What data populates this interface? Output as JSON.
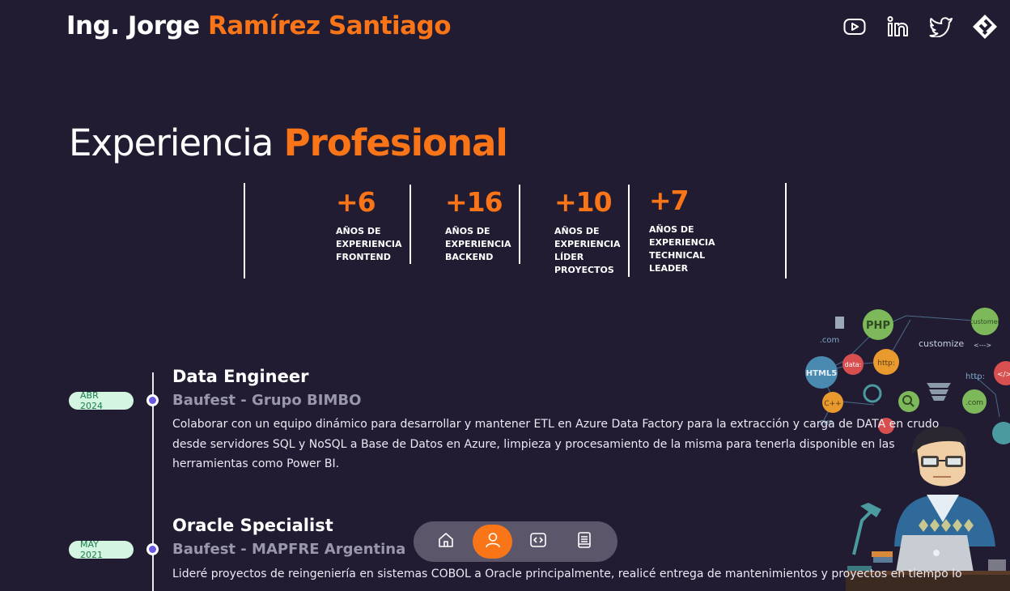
{
  "header": {
    "name_first": "Ing. Jorge ",
    "name_last": "Ramírez Santiago",
    "social": [
      "youtube-icon",
      "linkedin-icon",
      "twitter-icon",
      "platzi-icon"
    ]
  },
  "section": {
    "title_plain": "Experiencia ",
    "title_accent": "Profesional"
  },
  "stats": [
    {
      "value": "+6",
      "label_lines": [
        "AÑOS DE",
        "EXPERIENCIA",
        "FRONTEND"
      ]
    },
    {
      "value": "+16",
      "label_lines": [
        "AÑOS DE",
        "EXPERIENCIA",
        "BACKEND"
      ]
    },
    {
      "value": "+10",
      "label_lines": [
        "AÑOS DE",
        "EXPERIENCIA",
        "LÍDER",
        "PROYECTOS"
      ]
    },
    {
      "value": "+7",
      "label_lines": [
        "AÑOS DE",
        "EXPERIENCIA",
        "TECHNICAL",
        "LEADER"
      ]
    }
  ],
  "jobs": [
    {
      "date": "ABR 2024",
      "title": "Data Engineer",
      "company": "Baufest - Grupo BIMBO",
      "description": "Colaborar con un equipo dinámico para desarrollar y mantener ETL en Azure Data Factory para la extracción y carga de DATA en crudo desde servidores SQL y NoSQL a Base de Datos en Azure, limpieza y procesamiento de la misma para tenerla disponible en las herramientas como Power BI."
    },
    {
      "date": "MAY 2021",
      "title": "Oracle Specialist",
      "company": "Baufest - MAPFRE Argentina",
      "description": "Lideré proyectos de reingeniería en sistemas COBOL a Oracle principalmente, realicé entrega de mantenimientos y proyectos en tiempo lo"
    }
  ],
  "illustration_labels": [
    ".com",
    "PHP",
    "customize",
    "customer",
    "HTML5",
    "data:",
    "http:",
    "<--->",
    "http:",
    "C++",
    "PHP",
    ".com",
    "</>"
  ],
  "dock": {
    "items": [
      "home-icon",
      "user-icon",
      "code-icon",
      "book-icon"
    ],
    "active_index": 1
  },
  "colors": {
    "background": "#221c33",
    "accent": "#f97518",
    "badge_bg": "#d3f5e2",
    "badge_text": "#1a7d4a",
    "dot": "#6a5be2",
    "dock_bg": "#5c566a"
  }
}
